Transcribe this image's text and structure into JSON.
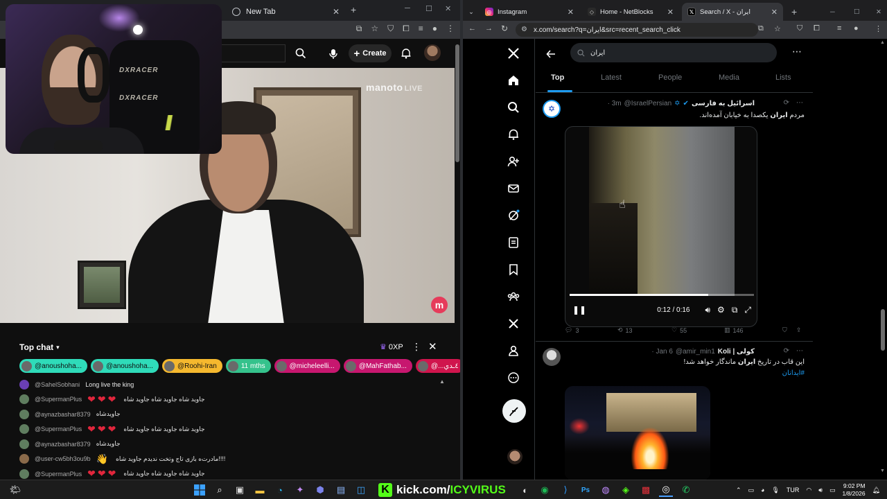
{
  "left_browser": {
    "tabs": [
      {
        "label": "New Tab"
      }
    ],
    "youtube": {
      "create_label": "Create"
    },
    "video": {
      "watermark": "manoto",
      "watermark_live": "LIVE",
      "logo_letter": "m",
      "chair_brand": "DXRACER"
    },
    "chat": {
      "title": "Top chat",
      "xp": "0XP",
      "chips": [
        {
          "label": "@anoushoha...",
          "style": "teal"
        },
        {
          "label": "@anoushoha...",
          "style": "teal"
        },
        {
          "label": "@Roohi-Iran",
          "style": "gold"
        },
        {
          "label": "11 mths",
          "style": "mint"
        },
        {
          "label": "@micheleelli...",
          "style": "pink"
        },
        {
          "label": "@MahFathab...",
          "style": "pink"
        },
        {
          "label": "@...٤ـﺪي",
          "style": "red"
        }
      ],
      "messages": [
        {
          "user": "@SahelSobhani",
          "text": "Long live the king",
          "hearts": "",
          "avatar": "#6a3fb5"
        },
        {
          "user": "@SupermanPlus",
          "text": "جاوید شاه جاوید شاه جاوید شاه",
          "hearts": "❤❤❤",
          "avatar": "#5f7d5f"
        },
        {
          "user": "@aynazbashar8379",
          "text": "جاویدشاه",
          "hearts": "",
          "avatar": "#5f7d5f"
        },
        {
          "user": "@SupermanPlus",
          "text": "جاوید شاه جاوید شاه جاوید شاه",
          "hearts": "❤❤❤",
          "avatar": "#5f7d5f"
        },
        {
          "user": "@aynazbashar8379",
          "text": "جاویدشاه",
          "hearts": "",
          "avatar": "#5f7d5f"
        },
        {
          "user": "@user-cw5bh3ou9b",
          "text": "مادرت‌ه بازی تاج وتخت ندیدم جاوید شاه!!!!",
          "hearts": "👋",
          "avatar": "#8a6a4a"
        },
        {
          "user": "@SupermanPlus",
          "text": "جاوید شاه جاوید شاه جاوید شاه",
          "hearts": "❤❤❤",
          "avatar": "#5f7d5f"
        }
      ]
    }
  },
  "right_browser": {
    "tabs": [
      {
        "label": "Instagram"
      },
      {
        "label": "Home - NetBlocks"
      },
      {
        "label": "Search / X - ایران"
      }
    ],
    "url": "x.com/search?q=ایران&src=recent_search_click",
    "x": {
      "search_query": "ایران",
      "tabs": [
        "Top",
        "Latest",
        "People",
        "Media",
        "Lists"
      ],
      "tweets": [
        {
          "name": "اسرائیل به فارسی",
          "handle": "@IsraelPersian",
          "time": "· 3m",
          "text_prefix": "مردم ",
          "text_highlight": "ایران",
          "text_suffix": " یکصدا به خیابان آمده‌اند.",
          "video_time": "0:12 / 0:16",
          "video_progress": 0.75,
          "replies": "3",
          "reposts": "13",
          "likes": "55",
          "views": "146"
        },
        {
          "name": "Koli | کولی",
          "handle": "@amir_min1",
          "time": "· Jan 6",
          "text_prefix": "این قاب در تاریخ ",
          "text_highlight": "ایران",
          "text_suffix": " ماندگار خواهد شد!",
          "hashtag": "#ایدانان"
        }
      ]
    }
  },
  "taskbar": {
    "kick_prefix": "kick.com/",
    "kick_name": "ICYVIRUS",
    "language": "TUR",
    "time": "9:02 PM",
    "date": "1/8/2026"
  }
}
